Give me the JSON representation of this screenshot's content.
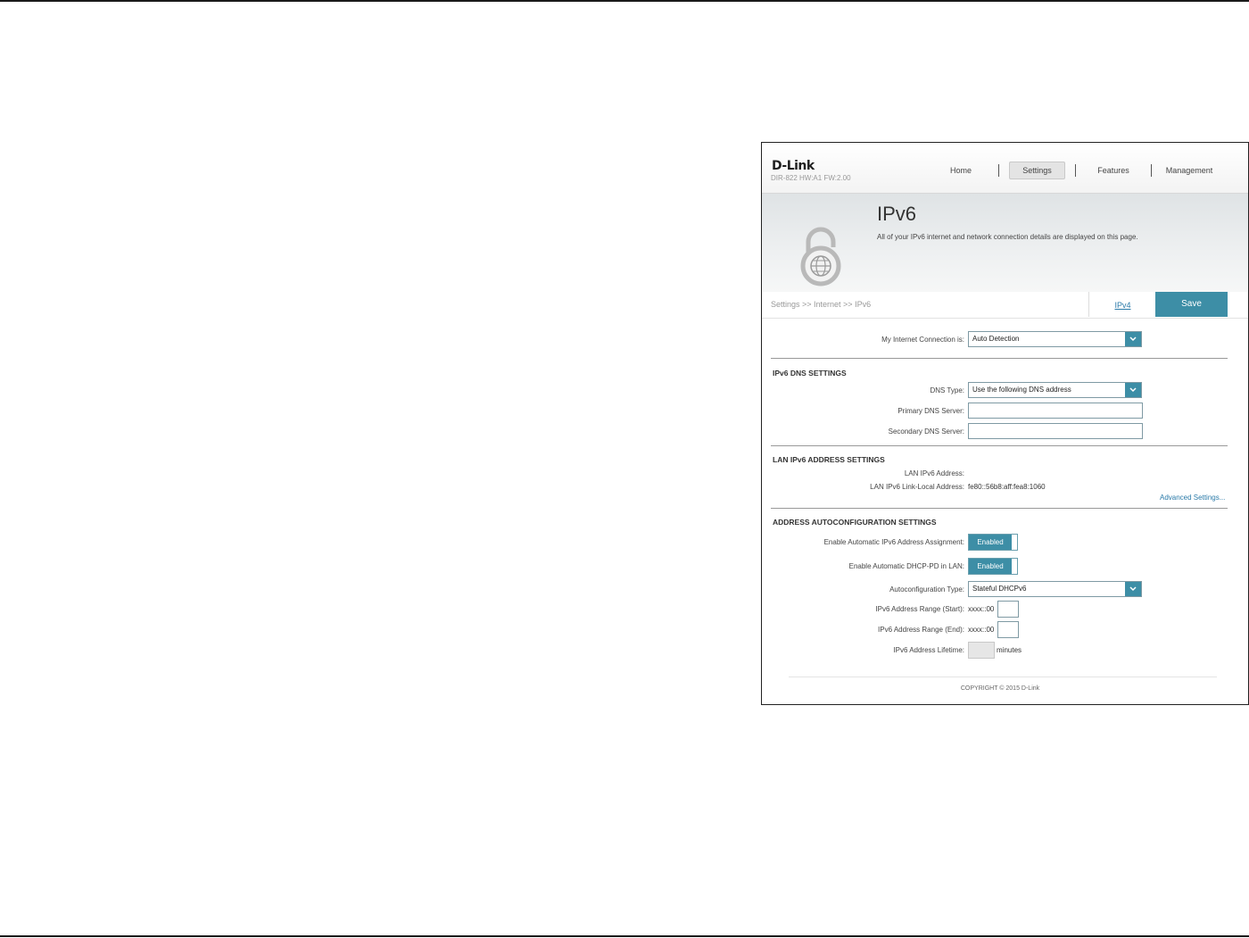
{
  "header": {
    "logo": "D-Link",
    "model": "DIR-822 HW:A1 FW:2.00",
    "nav": [
      {
        "label": "Home"
      },
      {
        "label": "Settings",
        "active": true
      },
      {
        "label": "Features"
      },
      {
        "label": "Management"
      }
    ]
  },
  "banner": {
    "title": "IPv6",
    "description": "All of your IPv6 internet and network connection details are displayed on this page.",
    "icon": "lock-globe-icon"
  },
  "toolbar": {
    "breadcrumb": "Settings >> Internet >> IPv6",
    "ipv4_link": "IPv4",
    "save_label": "Save"
  },
  "connection": {
    "label": "My Internet Connection is:",
    "value": "Auto Detection"
  },
  "dns": {
    "heading": "IPv6 DNS SETTINGS",
    "type_label": "DNS Type:",
    "type_value": "Use the following DNS address",
    "primary_label": "Primary DNS Server:",
    "primary_value": "",
    "secondary_label": "Secondary DNS Server:",
    "secondary_value": ""
  },
  "lan": {
    "heading": "LAN IPv6 ADDRESS SETTINGS",
    "address_label": "LAN IPv6 Address:",
    "address_value": "",
    "link_local_label": "LAN IPv6 Link-Local Address:",
    "link_local_value": "fe80::56b8:aff:fea8:1060",
    "advanced_link": "Advanced Settings..."
  },
  "autoconfig": {
    "heading": "ADDRESS AUTOCONFIGURATION SETTINGS",
    "auto_assign_label": "Enable Automatic IPv6 Address Assignment:",
    "auto_assign_value": "Enabled",
    "dhcp_pd_label": "Enable Automatic DHCP-PD in LAN:",
    "dhcp_pd_value": "Enabled",
    "type_label": "Autoconfiguration Type:",
    "type_value": "Stateful DHCPv6",
    "range_start_label": "IPv6 Address Range (Start):",
    "range_start_prefix": "xxxx::00",
    "range_end_label": "IPv6 Address Range (End):",
    "range_end_prefix": "xxxx::00",
    "lifetime_label": "IPv6 Address Lifetime:",
    "lifetime_unit": "minutes"
  },
  "footer": {
    "copyright": "COPYRIGHT © 2015 D-Link"
  },
  "colors": {
    "accent": "#3d8ea6",
    "link": "#2a7aa8"
  }
}
